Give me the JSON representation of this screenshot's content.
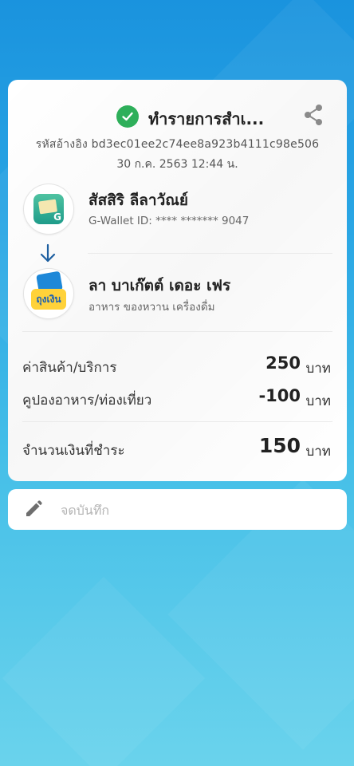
{
  "transaction": {
    "title": "ทำรายการสำเ...",
    "reference": "รหัสอ้างอิง bd3ec01ee2c74ee8a923b4111c98e506",
    "datetime": "30 ก.ค. 2563 12:44 น."
  },
  "sender": {
    "name": "สัสสิริ ลีลาวัณย์",
    "sub": "G-Wallet ID: **** ******* 9047",
    "logo_text": "G"
  },
  "receiver": {
    "name": "ลา บาเก๊ตต์ เดอะ เฟร",
    "sub": "อาหาร ของหวาน เครื่องดื่ม",
    "logo_text": "ถุงเงิน"
  },
  "summary": {
    "price_label": "ค่าสินค้า/บริการ",
    "price_amount": "250",
    "coupon_label": "คูปองอาหาร/ท่องเที่ยว",
    "coupon_amount": "-100",
    "total_label": "จำนวนเงินที่ชำระ",
    "total_amount": "150",
    "currency": "บาท"
  },
  "note": {
    "placeholder": "จดบันทึก"
  },
  "icons": {
    "success": "check-circle-icon",
    "share": "share-icon",
    "arrow": "arrow-down-icon",
    "note": "pencil-icon"
  },
  "colors": {
    "success_green": "#2eaf5a",
    "arrow_blue": "#1d5fa0",
    "background_top": "#1a93de",
    "background_bottom": "#6ad3ec"
  }
}
